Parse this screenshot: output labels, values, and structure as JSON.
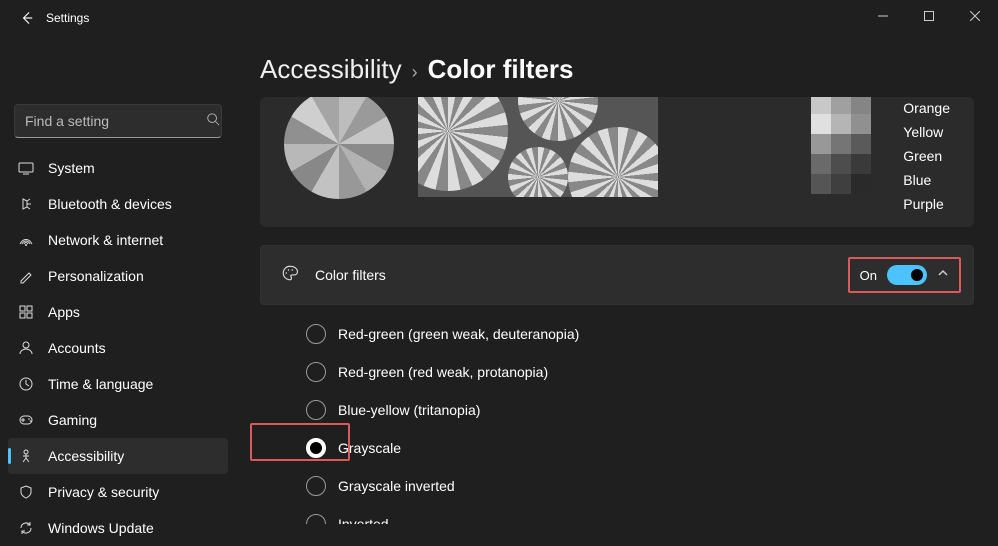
{
  "window": {
    "title": "Settings"
  },
  "search": {
    "placeholder": "Find a setting"
  },
  "nav": {
    "items": [
      {
        "label": "System"
      },
      {
        "label": "Bluetooth & devices"
      },
      {
        "label": "Network & internet"
      },
      {
        "label": "Personalization"
      },
      {
        "label": "Apps"
      },
      {
        "label": "Accounts"
      },
      {
        "label": "Time & language"
      },
      {
        "label": "Gaming"
      },
      {
        "label": "Accessibility"
      },
      {
        "label": "Privacy & security"
      },
      {
        "label": "Windows Update"
      }
    ],
    "selected": 8
  },
  "breadcrumb": {
    "parent": "Accessibility",
    "sep": "›",
    "current": "Color filters"
  },
  "preview": {
    "colors": [
      "Orange",
      "Yellow",
      "Green",
      "Blue",
      "Purple"
    ]
  },
  "expander": {
    "title": "Color filters",
    "state": "On"
  },
  "filters": {
    "options": [
      "Red-green (green weak, deuteranopia)",
      "Red-green (red weak, protanopia)",
      "Blue-yellow (tritanopia)",
      "Grayscale",
      "Grayscale inverted",
      "Inverted"
    ],
    "selected": 3
  }
}
